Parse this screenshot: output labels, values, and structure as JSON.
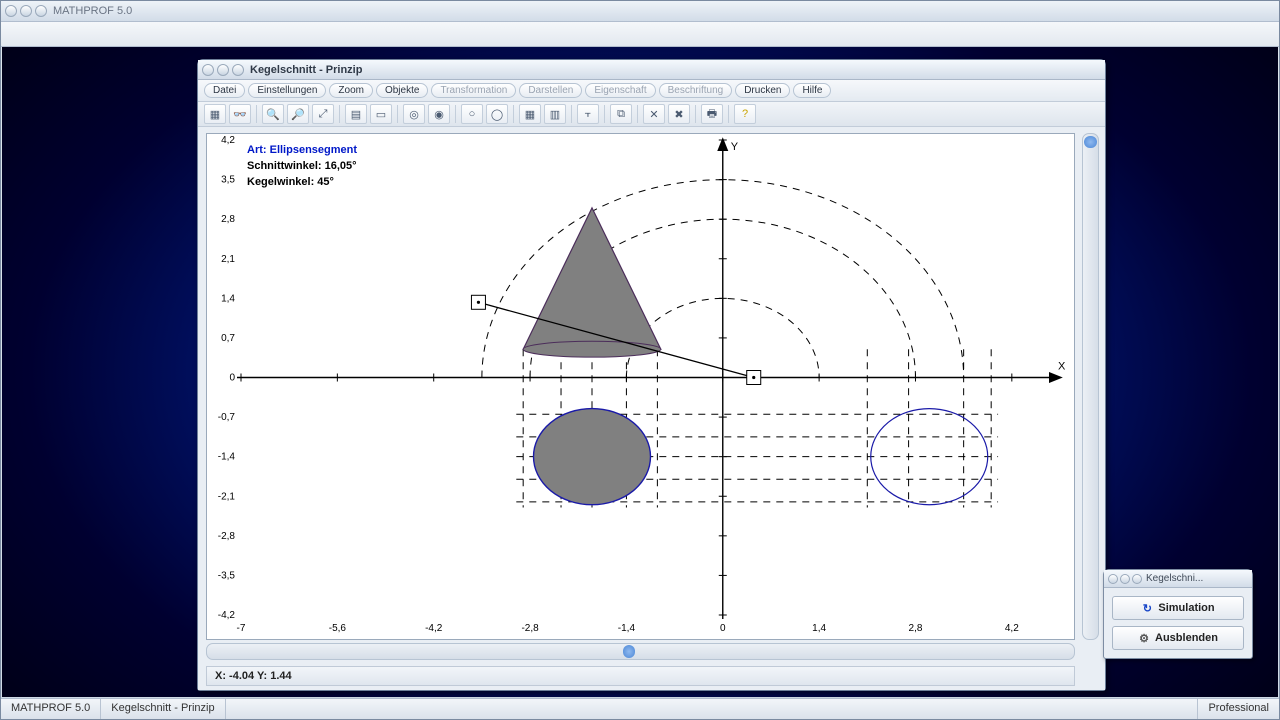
{
  "outer": {
    "title": "MATHPROF 5.0"
  },
  "statusbar": {
    "app": "MATHPROF 5.0",
    "doc": "Kegelschnitt - Prinzip",
    "edition": "Professional"
  },
  "child": {
    "title": "Kegelschnitt - Prinzip",
    "menus": [
      "Datei",
      "Einstellungen",
      "Zoom",
      "Objekte",
      "Transformation",
      "Darstellen",
      "Eigenschaft",
      "Beschriftung",
      "Drucken",
      "Hilfe"
    ],
    "menus_disabled": [
      4,
      5,
      6,
      7
    ],
    "coord": "X: -4.04     Y: 1.44"
  },
  "info": {
    "art_label": "Art:",
    "art_value": "Ellipsensegment",
    "schnitt": "Schnittwinkel: 16,05°",
    "kegel": "Kegelwinkel: 45°"
  },
  "float": {
    "title": "Kegelschni...",
    "btn1": "Simulation",
    "btn2": "Ausblenden"
  },
  "chart_data": {
    "type": "diagram",
    "title": "Kegelschnitt - Prinzip",
    "x_range": [
      -7,
      4.9
    ],
    "y_range": [
      -4.2,
      4.2
    ],
    "x_ticks": [
      -7,
      -5.6,
      -4.2,
      -2.8,
      -1.4,
      0,
      1.4,
      2.8,
      4.2
    ],
    "y_ticks": [
      -4.2,
      -3.5,
      -2.8,
      -2.1,
      -1.4,
      -0.7,
      0,
      0.7,
      1.4,
      2.1,
      2.8,
      3.5,
      4.2
    ],
    "x_axis_label": "X",
    "y_axis_label": "Y",
    "cone_front": {
      "apex": [
        -1.9,
        3.0
      ],
      "base_left": [
        -2.9,
        0.5
      ],
      "base_right": [
        -0.9,
        0.5
      ]
    },
    "dashed_arcs_center": [
      0,
      0
    ],
    "dashed_arcs_radii": [
      1.4,
      2.8,
      3.5
    ],
    "filled_circle": {
      "center": [
        -1.9,
        -1.4
      ],
      "radius": 0.85
    },
    "outline_circle": {
      "center": [
        3.0,
        -1.4
      ],
      "radius": 0.85
    },
    "section_line": {
      "p1": [
        -3.55,
        1.33
      ],
      "p2": [
        0.45,
        0.0
      ]
    },
    "handles": [
      [
        -3.55,
        1.33
      ],
      [
        0.45,
        0.0
      ]
    ],
    "construction_v_lines_x": [
      -2.9,
      -2.35,
      -1.9,
      -1.4,
      -0.95,
      2.1,
      2.7,
      3.5,
      3.9
    ],
    "construction_h_lines_y": [
      -0.65,
      -1.05,
      -1.4,
      -1.8,
      -2.2
    ],
    "art": "Ellipsensegment",
    "schnittwinkel_deg": 16.05,
    "kegelwinkel_deg": 45
  }
}
